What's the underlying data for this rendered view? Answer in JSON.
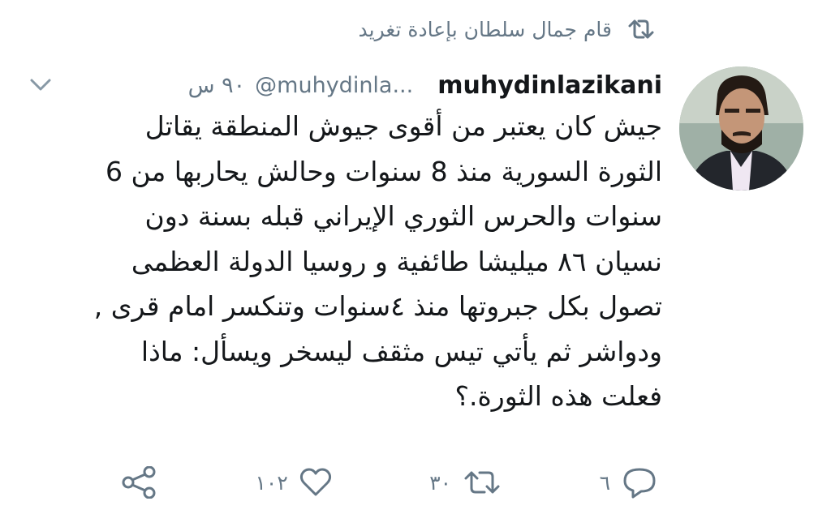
{
  "retweet_context": {
    "text": "قام جمال سلطان بإعادة تغريد",
    "icon": "retweet-icon"
  },
  "tweet": {
    "display_name": "muhydinlazikani",
    "handle": "@muhydinla...",
    "timestamp": "٩٠ س",
    "text": "جيش كان يعتبر من أقوى جيوش المنطقة يقاتل\nالثورة السورية منذ 8 سنوات وحالش يحاربها من 6\nسنوات والحرس الثوري الإيراني قبله بسنة دون\nنسيان ٨٦ ميليشا طائفية و روسيا الدولة العظمى\nتصول بكل جبروتها منذ ٤سنوات وتنكسر امام قرى ,\nودواشر ثم يأتي تيس مثقف ليسخر ويسأل: ماذا\nفعلت هذه الثورة.؟",
    "actions": {
      "reply_count": "٦",
      "retweet_count": "٣٠",
      "like_count": "١٠٢"
    }
  },
  "colors": {
    "text": "#14171a",
    "secondary": "#657786",
    "background": "#ffffff"
  }
}
